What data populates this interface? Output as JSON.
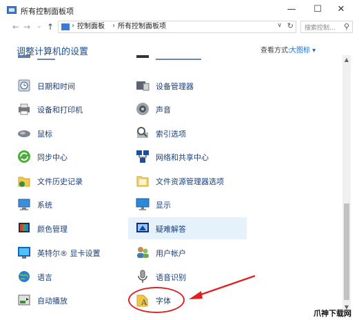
{
  "window": {
    "title": "所有控制面板项",
    "minimize": "—",
    "maximize": "☐",
    "close": "✕"
  },
  "nav": {
    "back": "←",
    "forward": "→",
    "history": "⌄",
    "up": "↑",
    "breadcrumbs": [
      "控制面板",
      "所有控制面板项"
    ],
    "separator": "›",
    "dropdown": "∨",
    "refresh": "↻",
    "search_placeholder": "搜索控制...",
    "search_icon": "⚲"
  },
  "header": {
    "title": "调整计算机的设置",
    "view_label": "查看方式:",
    "view_value": "大图标 ▾"
  },
  "items_left": [
    {
      "label": "日期和时间",
      "icon": "clock-icon"
    },
    {
      "label": "设备和打印机",
      "icon": "printer-icon"
    },
    {
      "label": "鼠标",
      "icon": "mouse-icon"
    },
    {
      "label": "同步中心",
      "icon": "sync-icon"
    },
    {
      "label": "文件历史记录",
      "icon": "file-history-icon"
    },
    {
      "label": "系统",
      "icon": "computer-icon"
    },
    {
      "label": "颜色管理",
      "icon": "color-management-icon"
    },
    {
      "label": "英特尔® 显卡设置",
      "icon": "intel-graphics-icon"
    },
    {
      "label": "语言",
      "icon": "language-icon"
    },
    {
      "label": "自动播放",
      "icon": "autoplay-icon"
    }
  ],
  "items_right": [
    {
      "label": "设备管理器",
      "icon": "device-manager-icon"
    },
    {
      "label": "声音",
      "icon": "speaker-icon"
    },
    {
      "label": "索引选项",
      "icon": "indexing-icon"
    },
    {
      "label": "网络和共享中心",
      "icon": "network-icon"
    },
    {
      "label": "文件资源管理器选项",
      "icon": "folder-options-icon"
    },
    {
      "label": "显示",
      "icon": "display-icon"
    },
    {
      "label": "疑难解答",
      "icon": "troubleshooting-icon"
    },
    {
      "label": "用户帐户",
      "icon": "users-icon"
    },
    {
      "label": "语音识别",
      "icon": "microphone-icon"
    },
    {
      "label": "字体",
      "icon": "font-icon"
    }
  ],
  "scrollbar": {
    "up": "▲",
    "down": "▼"
  },
  "watermark": "爪神下载网",
  "colors": {
    "link": "#1a3f7a",
    "heading": "#1e4e8c",
    "selection": "#e5f1fb",
    "annotation": "#e02020"
  }
}
